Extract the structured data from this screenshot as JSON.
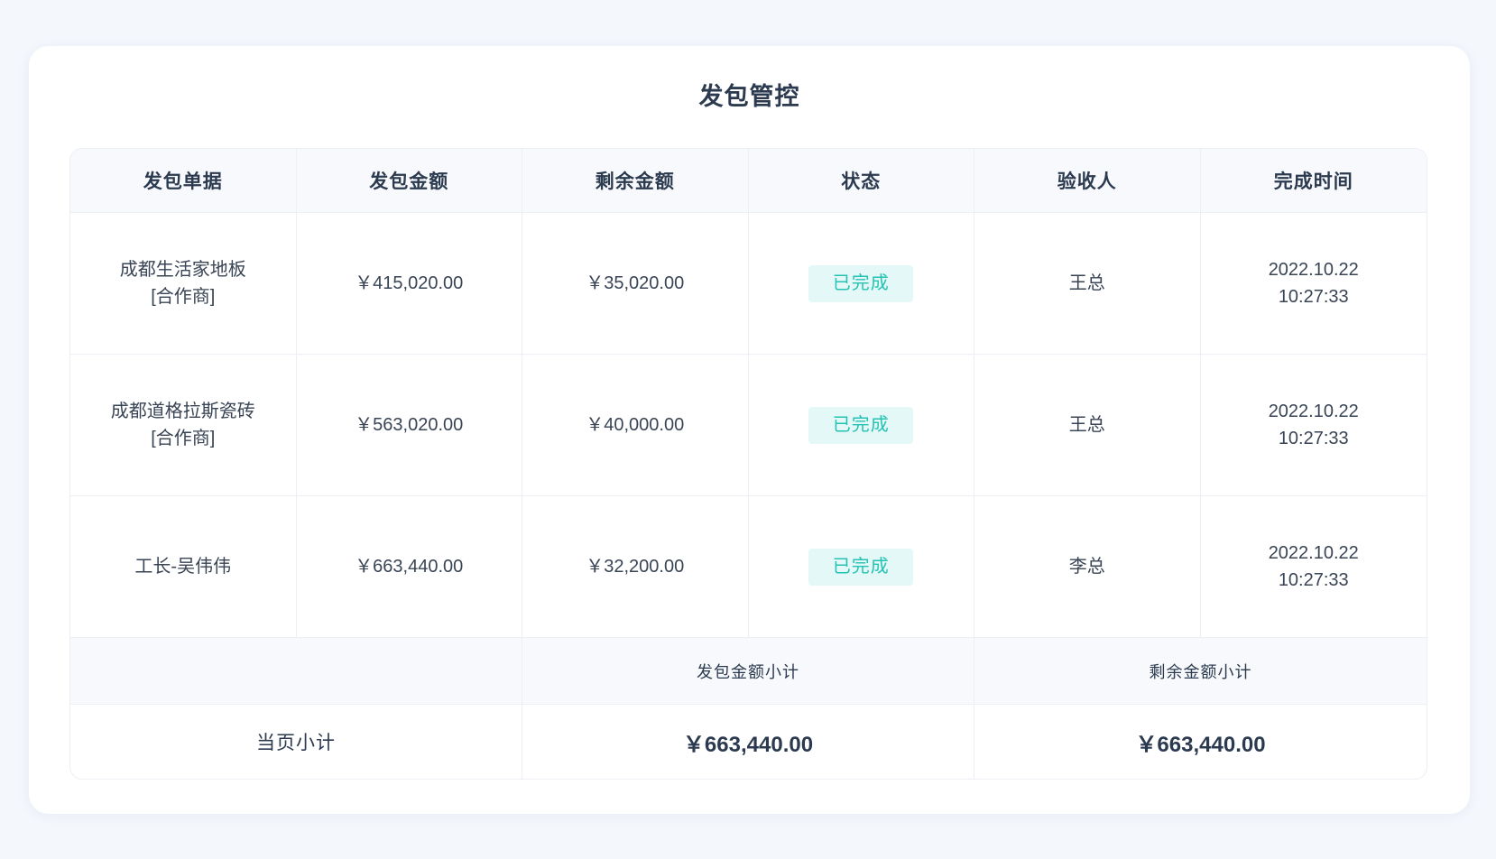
{
  "title": "发包管控",
  "columns": [
    "发包单据",
    "发包金额",
    "剩余金额",
    "状态",
    "验收人",
    "完成时间"
  ],
  "rows": [
    {
      "doc_name": "成都生活家地板",
      "doc_tag": "[合作商]",
      "amount": "￥415,020.00",
      "remaining": "￥35,020.00",
      "status": "已完成",
      "inspector": "王总",
      "date": "2022.10.22",
      "time": "10:27:33"
    },
    {
      "doc_name": "成都道格拉斯瓷砖",
      "doc_tag": "[合作商]",
      "amount": "￥563,020.00",
      "remaining": "￥40,000.00",
      "status": "已完成",
      "inspector": "王总",
      "date": "2022.10.22",
      "time": "10:27:33"
    },
    {
      "doc_name": "工长-吴伟伟",
      "amount": "￥663,440.00",
      "remaining": "￥32,200.00",
      "status": "已完成",
      "inspector": "李总",
      "date": "2022.10.22",
      "time": "10:27:33"
    }
  ],
  "footer": {
    "amount_label": "发包金额小计",
    "remaining_label": "剩余金额小计",
    "page_subtotal_label": "当页小计",
    "amount_total": "￥663,440.00",
    "remaining_total": "￥663,440.00"
  },
  "colors": {
    "page-bg": "#f4f7fc",
    "card-bg": "#ffffff",
    "head-bg": "#f7f9fc",
    "line": "#eceff4",
    "text": "#2b3a4f",
    "body": "#394455",
    "accent": "#25c2b4",
    "badge-bg": "#e4f9f7"
  }
}
